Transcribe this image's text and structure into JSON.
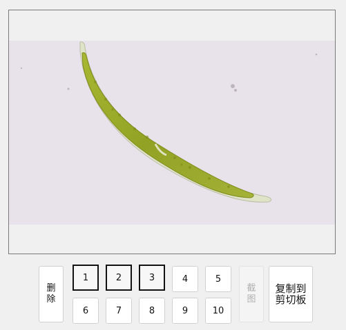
{
  "viewer": {
    "image_description_icon": "microscope-image"
  },
  "toolbar": {
    "delete_label": "删除",
    "screenshot_label": "截图",
    "copy_label": "复制到剪切板",
    "slots": [
      {
        "label": "1",
        "selected": true
      },
      {
        "label": "2",
        "selected": true
      },
      {
        "label": "3",
        "selected": true
      },
      {
        "label": "4",
        "selected": false
      },
      {
        "label": "5",
        "selected": false
      },
      {
        "label": "6",
        "selected": false
      },
      {
        "label": "7",
        "selected": false
      },
      {
        "label": "8",
        "selected": false
      },
      {
        "label": "9",
        "selected": false
      },
      {
        "label": "10",
        "selected": false
      }
    ]
  },
  "colors": {
    "background": "#f0f0f0",
    "photo_background": "#e8e3ea",
    "specimen_green": "#9aa82a"
  }
}
